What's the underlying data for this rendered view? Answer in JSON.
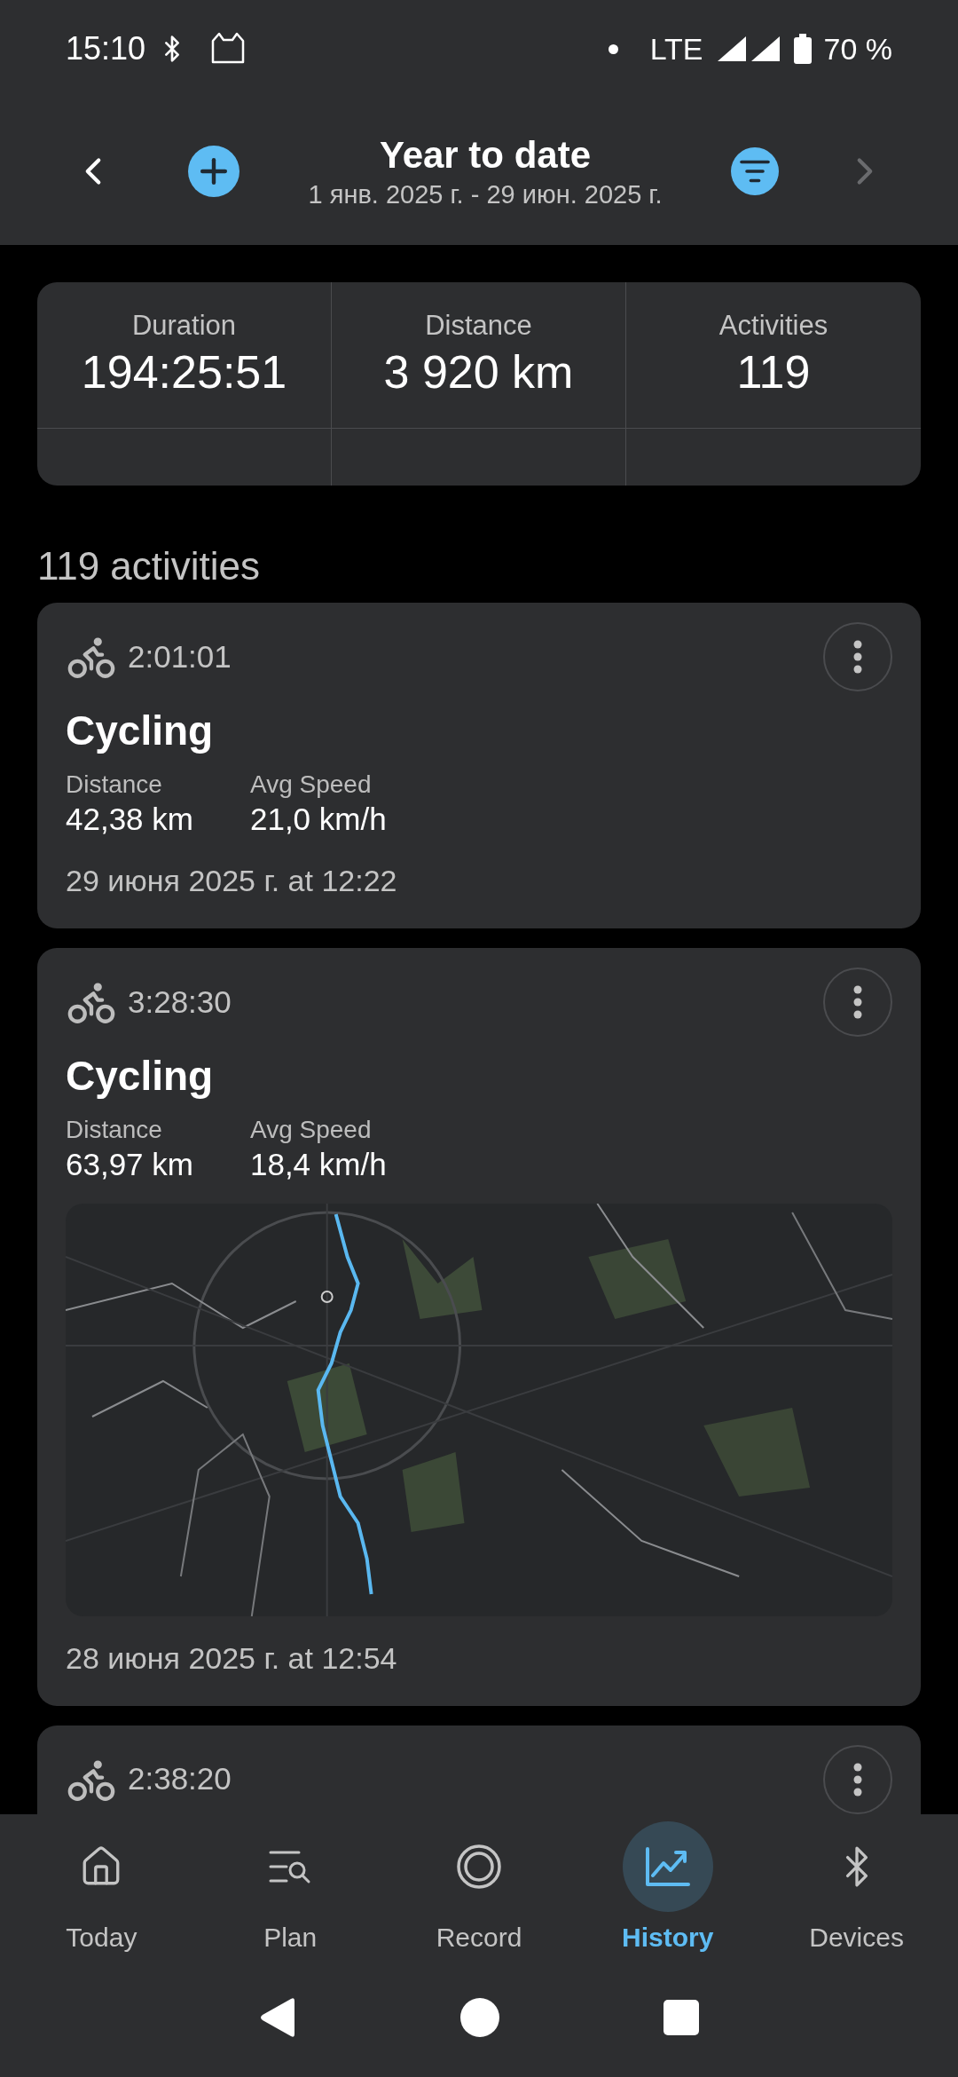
{
  "status_bar": {
    "time": "15:10",
    "network": "LTE",
    "battery": "70 %"
  },
  "header": {
    "title": "Year to date",
    "subtitle": "1 янв. 2025 г. - 29 июн. 2025 г."
  },
  "summary": [
    {
      "label": "Duration",
      "value": "194:25:51"
    },
    {
      "label": "Distance",
      "value": "3 920 km"
    },
    {
      "label": "Activities",
      "value": "119"
    }
  ],
  "list_title": "119 activities",
  "activities": [
    {
      "duration": "2:01:01",
      "title": "Cycling",
      "stats": [
        {
          "label": "Distance",
          "value": "42,38 km"
        },
        {
          "label": "Avg Speed",
          "value": "21,0 km/h"
        }
      ],
      "date": "29 июня 2025 г. at 12:22"
    },
    {
      "duration": "3:28:30",
      "title": "Cycling",
      "stats": [
        {
          "label": "Distance",
          "value": "63,97 km"
        },
        {
          "label": "Avg Speed",
          "value": "18,4 km/h"
        }
      ],
      "map": {
        "kind": "picture"
      },
      "date": "28 июня 2025 г. at 12:54"
    },
    {
      "duration": "2:38:20"
    }
  ],
  "nav": [
    {
      "label": "Today",
      "kind": "home",
      "selected": false
    },
    {
      "label": "Plan",
      "kind": "plan",
      "selected": false
    },
    {
      "label": "Record",
      "kind": "record",
      "selected": false
    },
    {
      "label": "History",
      "kind": "history",
      "selected": true
    },
    {
      "label": "Devices",
      "kind": "bluetooth",
      "selected": false
    }
  ]
}
